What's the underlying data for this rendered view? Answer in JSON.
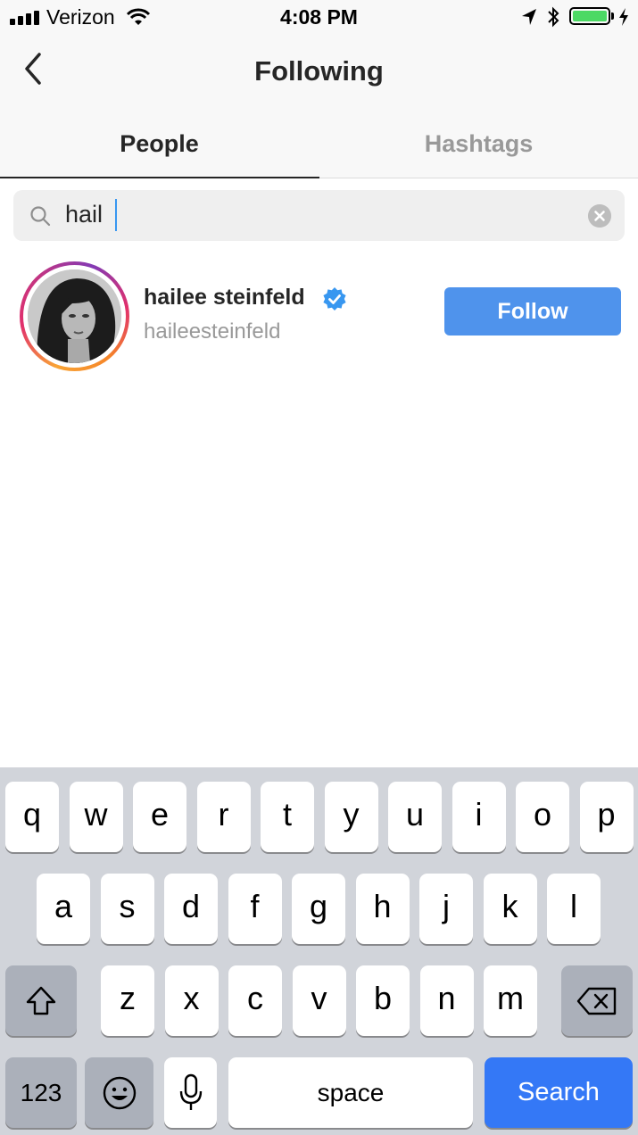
{
  "status_bar": {
    "carrier": "Verizon",
    "time": "4:08 PM",
    "battery_level": 1.0
  },
  "header": {
    "title": "Following"
  },
  "tabs": [
    {
      "label": "People",
      "active": true
    },
    {
      "label": "Hashtags",
      "active": false
    }
  ],
  "search": {
    "query": "hail"
  },
  "results": [
    {
      "display_name": "hailee steinfeld",
      "username": "haileesteinfeld",
      "verified": true,
      "button_label": "Follow"
    }
  ],
  "keyboard": {
    "row1": [
      "q",
      "w",
      "e",
      "r",
      "t",
      "y",
      "u",
      "i",
      "o",
      "p"
    ],
    "row2": [
      "a",
      "s",
      "d",
      "f",
      "g",
      "h",
      "j",
      "k",
      "l"
    ],
    "row3": [
      "z",
      "x",
      "c",
      "v",
      "b",
      "n",
      "m"
    ],
    "numbers_label": "123",
    "space_label": "space",
    "search_label": "Search"
  },
  "colors": {
    "accent": "#4f93ec",
    "search_key": "#3478f6",
    "verified": "#3897f0"
  },
  "icons": [
    "back-chevron-icon",
    "search-icon",
    "clear-icon",
    "verified-badge-icon",
    "shift-icon",
    "backspace-icon",
    "emoji-icon",
    "microphone-icon"
  ]
}
